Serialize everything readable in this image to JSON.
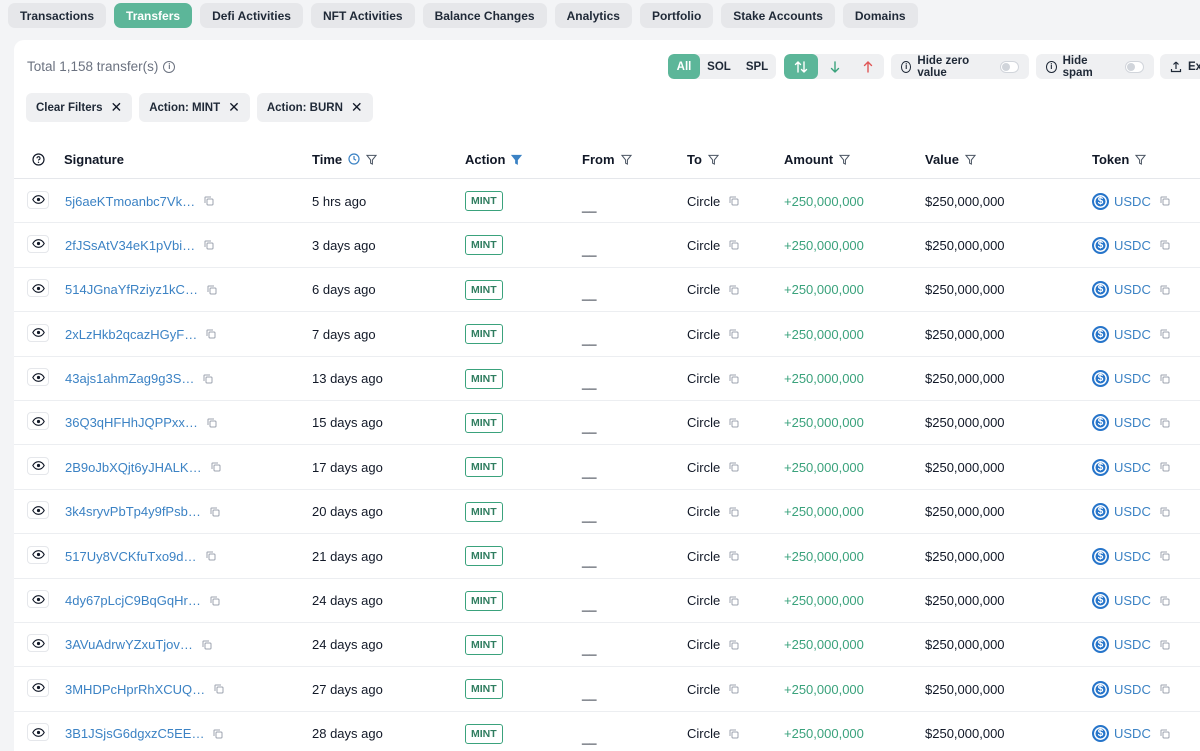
{
  "tabs": [
    {
      "label": "Transactions",
      "active": false
    },
    {
      "label": "Transfers",
      "active": true
    },
    {
      "label": "Defi Activities",
      "active": false
    },
    {
      "label": "NFT Activities",
      "active": false
    },
    {
      "label": "Balance Changes",
      "active": false
    },
    {
      "label": "Analytics",
      "active": false
    },
    {
      "label": "Portfolio",
      "active": false
    },
    {
      "label": "Stake Accounts",
      "active": false
    },
    {
      "label": "Domains",
      "active": false
    }
  ],
  "summary": {
    "total_text": "Total 1,158 transfer(s)"
  },
  "type_filter": {
    "options": [
      "All",
      "SOL",
      "SPL"
    ],
    "selected": "All"
  },
  "direction_filter": {
    "options": [
      "both-arrows-icon",
      "arrow-down-icon",
      "arrow-up-icon"
    ],
    "selected": "both-arrows-icon"
  },
  "toggles": {
    "hide_zero_value": "Hide zero value",
    "hide_spam": "Hide spam",
    "export": "Exp"
  },
  "filters": {
    "clear": "Clear Filters",
    "chips": [
      "Action: MINT",
      "Action: BURN"
    ]
  },
  "table": {
    "columns": {
      "signature": "Signature",
      "time": "Time",
      "action": "Action",
      "from": "From",
      "to": "To",
      "amount": "Amount",
      "value": "Value",
      "token": "Token"
    },
    "rows": [
      {
        "signature": "5j6aeKTmoanbc7Vk…",
        "time": "5 hrs ago",
        "action": "MINT",
        "from": "__",
        "to": "Circle",
        "amount": "+250,000,000",
        "value": "$250,000,000",
        "token": "USDC"
      },
      {
        "signature": "2fJSsAtV34eK1pVbi…",
        "time": "3 days ago",
        "action": "MINT",
        "from": "__",
        "to": "Circle",
        "amount": "+250,000,000",
        "value": "$250,000,000",
        "token": "USDC"
      },
      {
        "signature": "514JGnaYfRziyz1kC…",
        "time": "6 days ago",
        "action": "MINT",
        "from": "__",
        "to": "Circle",
        "amount": "+250,000,000",
        "value": "$250,000,000",
        "token": "USDC"
      },
      {
        "signature": "2xLzHkb2qcazHGyF…",
        "time": "7 days ago",
        "action": "MINT",
        "from": "__",
        "to": "Circle",
        "amount": "+250,000,000",
        "value": "$250,000,000",
        "token": "USDC"
      },
      {
        "signature": "43ajs1ahmZag9g3S…",
        "time": "13 days ago",
        "action": "MINT",
        "from": "__",
        "to": "Circle",
        "amount": "+250,000,000",
        "value": "$250,000,000",
        "token": "USDC"
      },
      {
        "signature": "36Q3qHFHhJQPPxx…",
        "time": "15 days ago",
        "action": "MINT",
        "from": "__",
        "to": "Circle",
        "amount": "+250,000,000",
        "value": "$250,000,000",
        "token": "USDC"
      },
      {
        "signature": "2B9oJbXQjt6yJHALK…",
        "time": "17 days ago",
        "action": "MINT",
        "from": "__",
        "to": "Circle",
        "amount": "+250,000,000",
        "value": "$250,000,000",
        "token": "USDC"
      },
      {
        "signature": "3k4sryvPbTp4y9fPsb…",
        "time": "20 days ago",
        "action": "MINT",
        "from": "__",
        "to": "Circle",
        "amount": "+250,000,000",
        "value": "$250,000,000",
        "token": "USDC"
      },
      {
        "signature": "517Uy8VCKfuTxo9d…",
        "time": "21 days ago",
        "action": "MINT",
        "from": "__",
        "to": "Circle",
        "amount": "+250,000,000",
        "value": "$250,000,000",
        "token": "USDC"
      },
      {
        "signature": "4dy67pLcjC9BqGqHr…",
        "time": "24 days ago",
        "action": "MINT",
        "from": "__",
        "to": "Circle",
        "amount": "+250,000,000",
        "value": "$250,000,000",
        "token": "USDC"
      },
      {
        "signature": "3AVuAdrwYZxuTjov…",
        "time": "24 days ago",
        "action": "MINT",
        "from": "__",
        "to": "Circle",
        "amount": "+250,000,000",
        "value": "$250,000,000",
        "token": "USDC"
      },
      {
        "signature": "3MHDPcHprRhXCUQ…",
        "time": "27 days ago",
        "action": "MINT",
        "from": "__",
        "to": "Circle",
        "amount": "+250,000,000",
        "value": "$250,000,000",
        "token": "USDC"
      },
      {
        "signature": "3B1JSjsG6dgxzC5EE…",
        "time": "28 days ago",
        "action": "MINT",
        "from": "__",
        "to": "Circle",
        "amount": "+250,000,000",
        "value": "$250,000,000",
        "token": "USDC"
      }
    ]
  },
  "colors": {
    "accent": "#5cb699",
    "link": "#3b82c4",
    "positive": "#3aa27c",
    "usdc": "#2775ca"
  }
}
